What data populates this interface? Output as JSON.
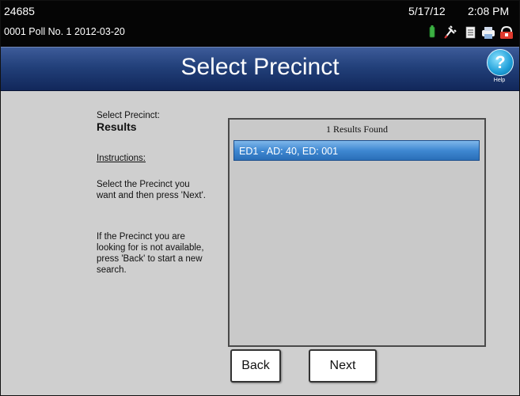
{
  "status": {
    "id": "24685",
    "poll": "0001 Poll No. 1   2012-03-20",
    "date": "5/17/12",
    "time": "2:08 PM",
    "icons": [
      "battery-icon",
      "plug-icon",
      "document-icon",
      "printer-icon",
      "lock-icon"
    ]
  },
  "header": {
    "title": "Select Precinct",
    "help_label": "Help",
    "help_symbol": "?"
  },
  "left": {
    "select_label": "Select Precinct:",
    "results_label": "Results",
    "instructions_label": "Instructions:",
    "paragraph1": "Select the Precinct you want and then press 'Next'.",
    "paragraph2": "If the Precinct you are looking for is not available, press 'Back' to start a new search."
  },
  "list": {
    "header": "1 Results Found",
    "items": [
      {
        "label": "ED1 - AD: 40, ED: 001",
        "selected": true
      }
    ]
  },
  "buttons": {
    "back": "Back",
    "next": "Next"
  },
  "colors": {
    "title_bar": "#22407a",
    "selected_row": "#3f88d2",
    "background": "#cfcfcf"
  }
}
